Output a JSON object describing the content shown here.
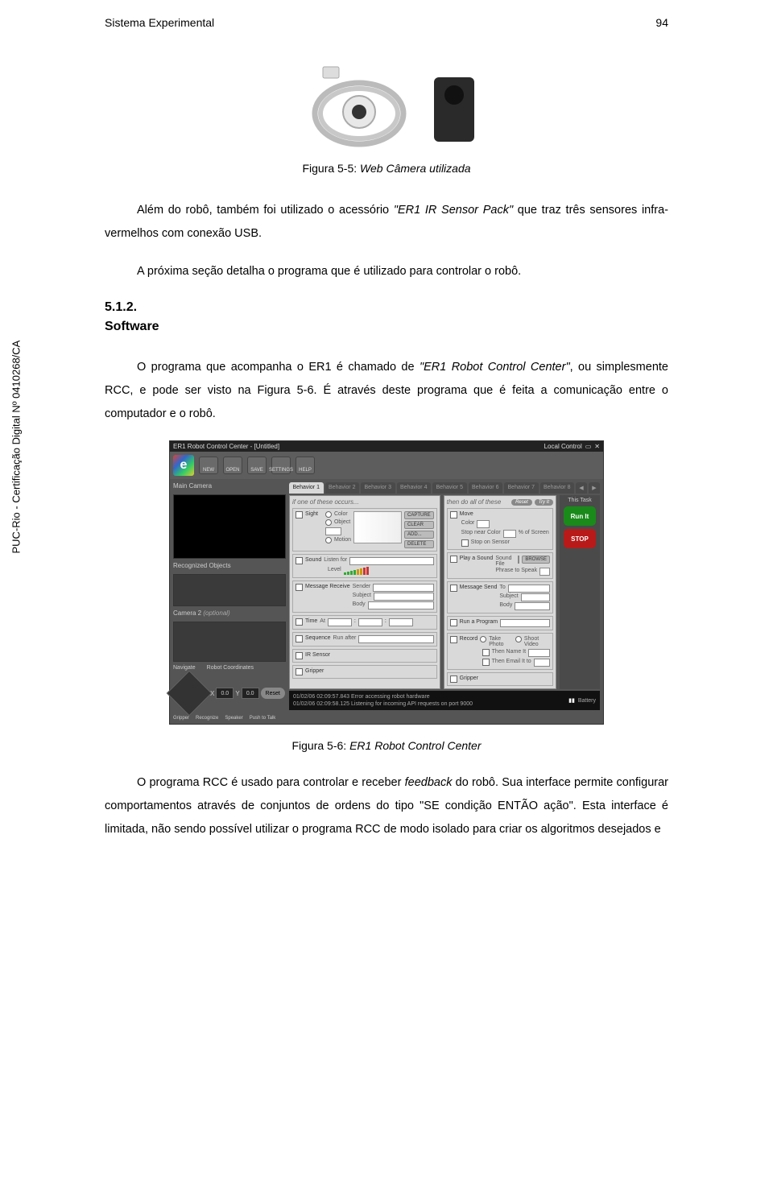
{
  "header": {
    "left": "Sistema Experimental",
    "pageNumber": "94"
  },
  "sidebar_label": "PUC-Rio - Certificação Digital Nº 0410268/CA",
  "fig1": {
    "label": "Figura 5-5:",
    "title_italic": "Web Câmera utilizada"
  },
  "para1_a": "Além do robô, também foi utilizado o acessório ",
  "para1_b_ital": "\"ER1 IR Sensor Pack\"",
  "para1_c": " que traz três sensores infra-vermelhos com conexão USB.",
  "para2": "A próxima seção detalha o programa que é utilizado para controlar o robô.",
  "section": {
    "num": "5.1.2.",
    "title": "Software"
  },
  "para3_a": "O programa que acompanha o ER1 é chamado de ",
  "para3_b_ital": "\"ER1 Robot Control Center\"",
  "para3_c": ", ou simplesmente RCC, e pode ser visto na Figura 5-6. É através deste programa que é feita a comunicação entre o computador e o robô.",
  "rcc": {
    "title": "ER1 Robot Control Center - [Untitled]",
    "local_control": "Local Control",
    "toolbar": [
      "NEW",
      "OPEN",
      "SAVE",
      "SETTINGS",
      "HELP"
    ],
    "left": {
      "main_camera": "Main Camera",
      "recognized": "Recognized Objects",
      "camera2": "Camera 2",
      "camera2_opt": "(optional)",
      "navigate": "Navigate",
      "coords": "Robot Coordinates",
      "x": "X",
      "xval": "0.0",
      "y": "Y",
      "yval": "0.0",
      "reset": "Reset",
      "icons": [
        "Gripper",
        "Recognize",
        "Speaker",
        "Push to Talk"
      ]
    },
    "tabs": [
      "Behavior 1",
      "Behavior 2",
      "Behavior 3",
      "Behavior 4",
      "Behavior 5",
      "Behavior 6",
      "Behavior 7",
      "Behavior 8"
    ],
    "if_header": "if one of these occurs...",
    "then_header": "then do all of these",
    "reset_btn": "Reset",
    "try_btn": "Try It",
    "this_task": "This Task",
    "run": "Run It",
    "stop": "STOP",
    "if_col": {
      "sight": "Sight",
      "color": "Color",
      "object": "Object",
      "motion": "Motion",
      "capture": "CAPTURE",
      "clear": "CLEAR",
      "add": "ADD...",
      "delete": "DELETE",
      "sound": "Sound",
      "listen_for": "Listen for",
      "level": "Level",
      "message": "Message Receive",
      "sender": "Sender",
      "subject": "Subject",
      "body": "Body",
      "time": "Time",
      "at": "At",
      "sequence": "Sequence",
      "run_after": "Run after",
      "ir": "IR Sensor",
      "gripper": "Gripper"
    },
    "then_col": {
      "move": "Move",
      "color": "Color",
      "stop_near": "Stop near Color",
      "pct": "% of Screen",
      "stop_sensor": "Stop on Sensor",
      "play": "Play a Sound",
      "sound_file": "Sound File",
      "phrase": "Phrase to Speak",
      "browse": "BROWSE",
      "msend": "Message Send",
      "to": "To",
      "subject": "Subject",
      "body": "Body",
      "run_prog": "Run a Program",
      "record": "Record",
      "take_photo": "Take Photo",
      "shoot_video": "Shoot Video",
      "then_name": "Then Name It",
      "then_email": "Then Email It to",
      "gripper": "Gripper"
    },
    "status": {
      "l1": "01/02/06 02:09:57.843 Error accessing robot hardware",
      "l2": "01/02/06 02:09:58.125 Listening for incoming API requests on port 9000",
      "battery": "Battery"
    }
  },
  "fig2": {
    "label": "Figura 5-6:",
    "title_italic": "ER1 Robot Control Center"
  },
  "para4_a": "O programa RCC é usado para controlar e receber ",
  "para4_b_ital": "feedback",
  "para4_c": " do robô. Sua interface permite configurar comportamentos através de conjuntos de ordens do tipo \"SE condição ENTÃO ação\". Esta interface é limitada, não sendo possível utilizar o programa RCC de modo isolado para criar os algoritmos desejados e"
}
